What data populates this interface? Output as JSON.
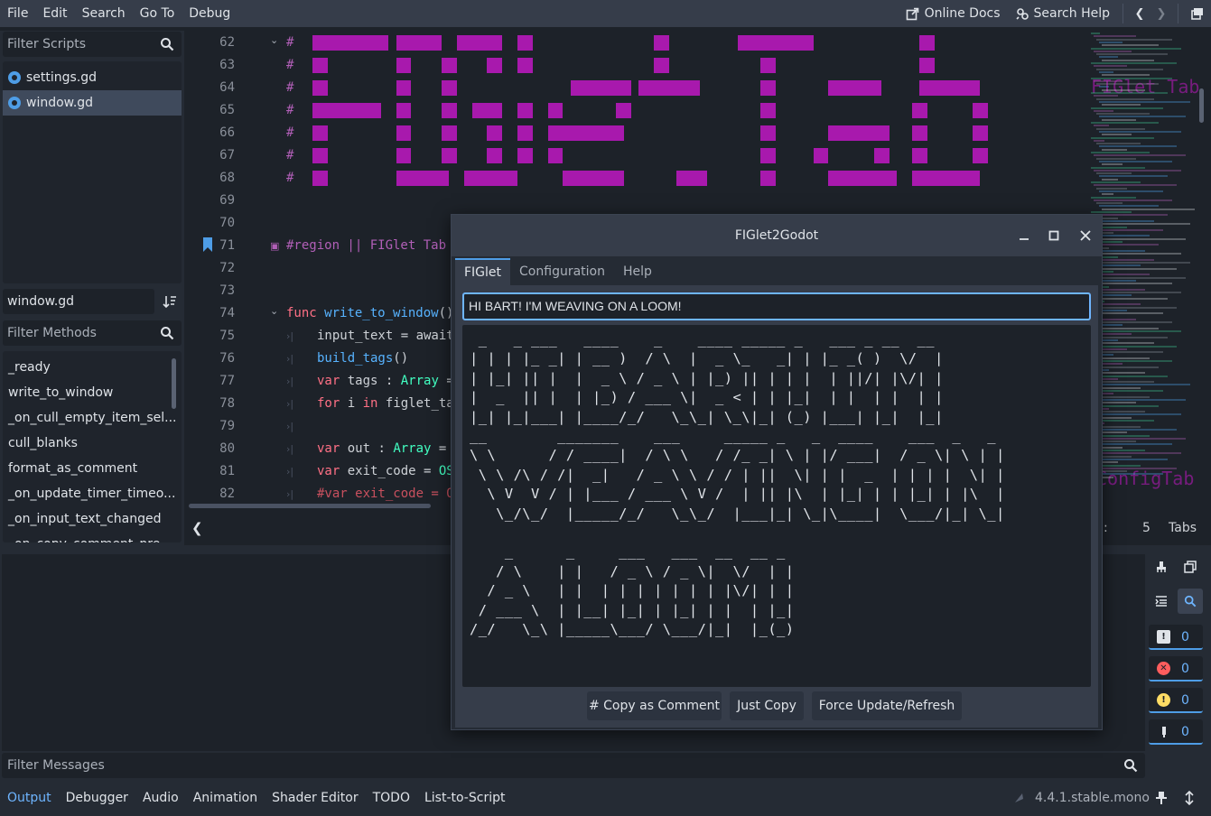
{
  "menu": {
    "items": [
      "File",
      "Edit",
      "Search",
      "Go To",
      "Debug"
    ],
    "online_docs": "Online Docs",
    "search_help": "Search Help"
  },
  "scripts_panel": {
    "filter_placeholder": "Filter Scripts",
    "scripts": [
      "settings.gd",
      "window.gd"
    ],
    "current_script": "window.gd",
    "methods_filter_placeholder": "Filter Methods",
    "methods": [
      "_ready",
      "write_to_window",
      "_on_cull_empty_item_sel...",
      "cull_blanks",
      "format_as_comment",
      "_on_update_timer_timeo...",
      "_on_input_text_changed",
      "_on_copy_comment_pre..."
    ]
  },
  "editor": {
    "line_numbers": [
      "62",
      "63",
      "64",
      "65",
      "66",
      "67",
      "68",
      "69",
      "70",
      "71",
      "72",
      "73",
      "74",
      "75",
      "76",
      "77",
      "78",
      "79",
      "80",
      "81",
      "82"
    ],
    "lines": {
      "l71": "#region || FIGlet Tab",
      "l74_kw": "func",
      "l74_fn": "write_to_window",
      "l74_rest": "()",
      "l75": "input_text = await",
      "l76_fn": "build_tags",
      "l76_rest": "()",
      "l77_kw": "var",
      "l77_a": " tags : ",
      "l77_ty": "Array",
      "l77_b": " =",
      "l78_kw": "for",
      "l78_a": " i ",
      "l78_kw2": "in",
      "l78_b": " figlet_ta",
      "l80_kw": "var",
      "l80_a": " out : ",
      "l80_ty": "Array",
      "l80_b": " =",
      "l81_kw": "var",
      "l81_a": " exit_code = ",
      "l81_ty": "OS",
      "l82": "#var exit_code = O"
    },
    "minimap_labels": [
      "FIGlet Tab",
      "ConfigTab"
    ],
    "status": {
      "column": "5",
      "indent": "Tabs",
      "sep": ":"
    }
  },
  "figlet_window": {
    "title": "FIGlet2Godot",
    "tabs": [
      "FIGlet",
      "Configuration",
      "Help"
    ],
    "input_value": "HI BART! I'M WEAVING ON A LOOM!",
    "ascii_art": " _   _ ___   ____    _    ____ _____ _   ___ _ __  __ \n| | | |_ _| | __ )  / \\  |  _ \\_   _| | |_ _( )  \\/  |\n| |_| || |  |  _ \\ / _ \\ | |_) || | | |  | ||/| |\\/| |\n|  _  || |  | |_) / ___ \\|  _ < | | |_|  | |  | |  | |\n|_| |_|___| |____/_/   \\_\\_| \\_\\|_| (_) |___| |_|  |_|\n__        _______    ___     _____ _   _  ____    ___  _   _ \n\\ \\      / / ____|  / \\ \\   / /_ _| \\ | |/ ___|  / _ \\| \\ | |\n \\ \\ /\\ / /|  _|   / _ \\ \\ / / | ||  \\| | |  _  | | | |  \\| |\n  \\ V  V / | |___ / ___ \\ V /  | || |\\  | |_| | | |_| | |\\  |\n   \\_/\\_/  |_____/_/   \\_\\_/  |___|_| \\_|\\____|  \\___/|_| \\_|\n\n    _      _     ___   ___  __  __ _ \n   / \\    | |   / _ \\ / _ \\|  \\/  | |\n  / _ \\   | |  | | | | | | | |\\/| | |\n / ___ \\  | |__| |_| | |_| | |  | |_|\n/_/   \\_\\ |_____\\___/ \\___/|_|  |_(_)",
    "buttons": [
      "# Copy as Comment",
      "Just Copy",
      "Force Update/Refresh"
    ]
  },
  "bottom_panel": {
    "filter_placeholder": "Filter Messages",
    "tabs": [
      "Output",
      "Debugger",
      "Audio",
      "Animation",
      "Shader Editor",
      "TODO",
      "List-to-Script"
    ],
    "active_tab": "Output",
    "version": "4.4.1.stable.mono",
    "counts": {
      "messages": "0",
      "errors": "0",
      "warnings": "0",
      "editor": "0"
    }
  },
  "colors": {
    "accent": "#6eb5ff",
    "figlet_magenta": "#c118c4",
    "comment": "#b15fb7"
  }
}
